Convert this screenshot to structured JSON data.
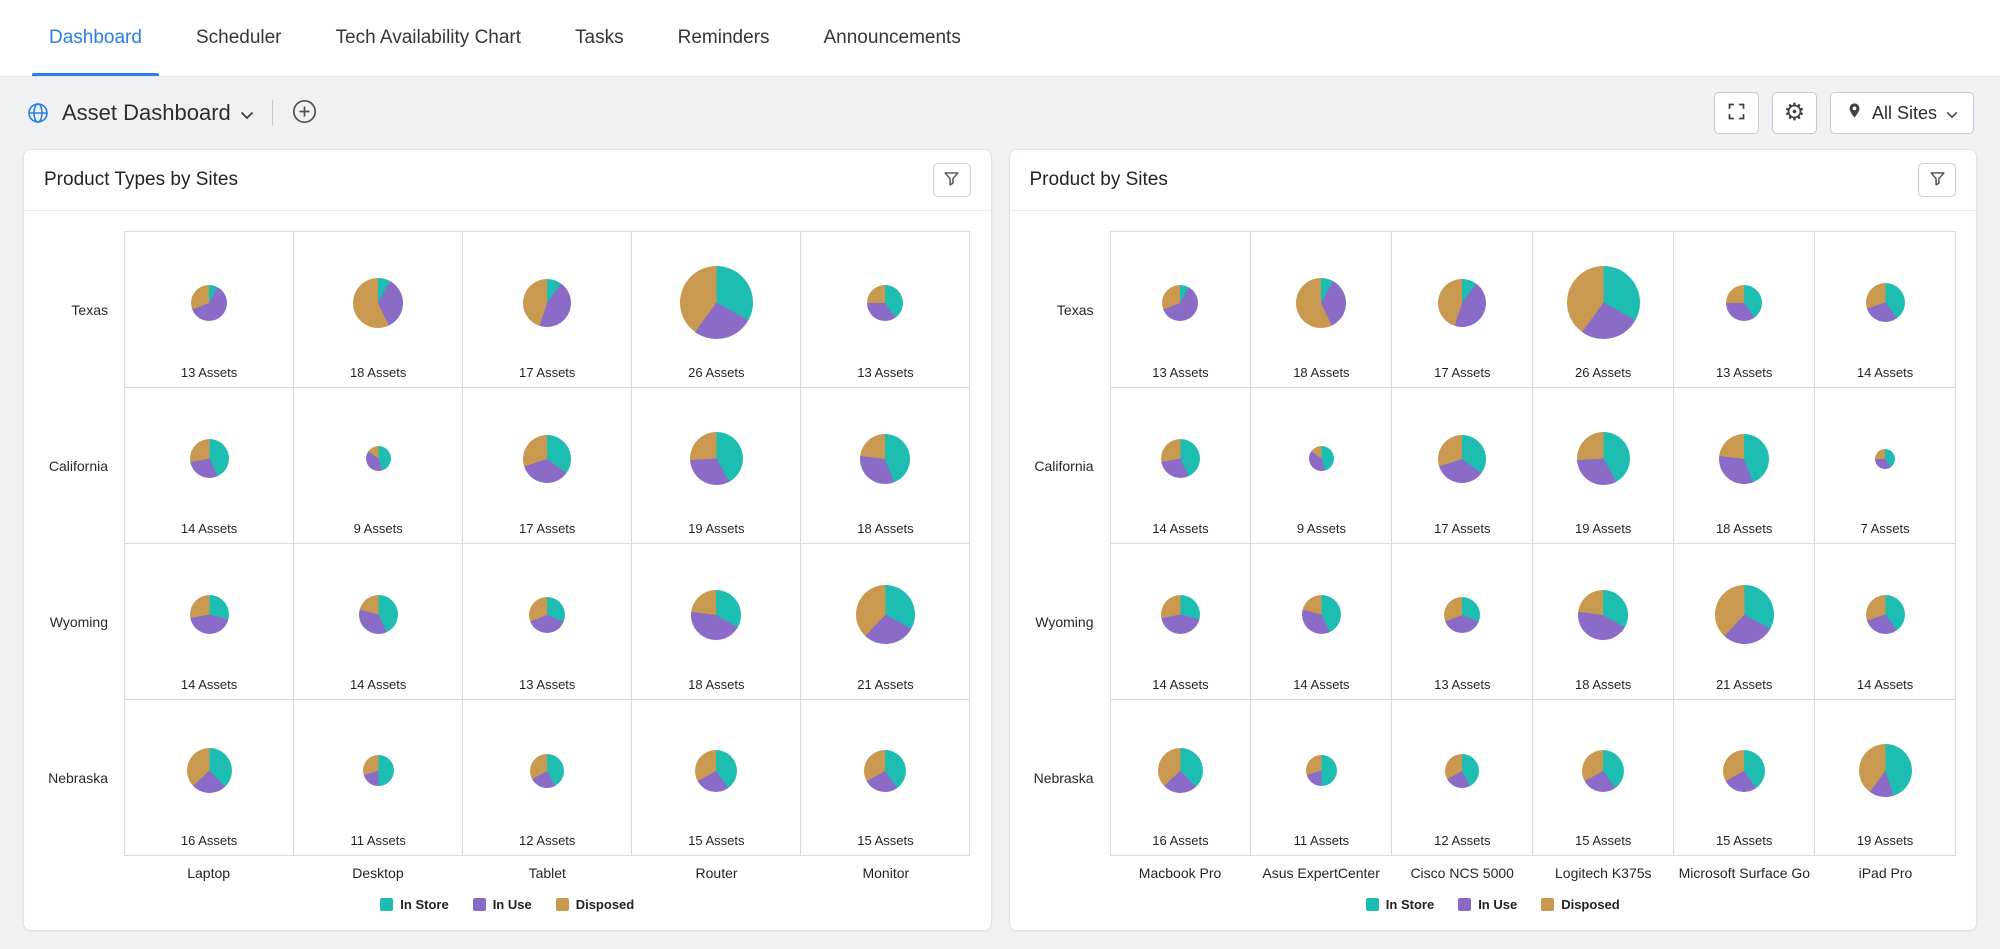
{
  "nav": {
    "tabs": [
      {
        "label": "Dashboard",
        "active": true
      },
      {
        "label": "Scheduler",
        "active": false
      },
      {
        "label": "Tech Availability Chart",
        "active": false
      },
      {
        "label": "Tasks",
        "active": false
      },
      {
        "label": "Reminders",
        "active": false
      },
      {
        "label": "Announcements",
        "active": false
      }
    ]
  },
  "toolbar": {
    "title": "Asset Dashboard",
    "site_filter_label": "All Sites"
  },
  "colors": {
    "accent_blue": "#2b7de9",
    "in_store": "#1ebdb2",
    "in_use": "#8a6cc8",
    "disposed": "#c9994f"
  },
  "chart_data": [
    {
      "type": "pie",
      "title": "Product Types by Sites",
      "rows": [
        "Texas",
        "California",
        "Wyoming",
        "Nebraska"
      ],
      "columns": [
        "Laptop",
        "Desktop",
        "Tablet",
        "Router",
        "Monitor"
      ],
      "series_labels": [
        "In Store",
        "In Use",
        "Disposed"
      ],
      "series_colors": [
        "#1ebdb2",
        "#8a6cc8",
        "#c9994f"
      ],
      "count_suffix": "Assets",
      "cells": [
        [
          {
            "total": 13,
            "pct": [
              8,
              61,
              31
            ]
          },
          {
            "total": 18,
            "pct": [
              8,
              35,
              57
            ]
          },
          {
            "total": 17,
            "pct": [
              10,
              45,
              45
            ]
          },
          {
            "total": 26,
            "pct": [
              33,
              27,
              40
            ]
          },
          {
            "total": 13,
            "pct": [
              40,
              35,
              25
            ]
          }
        ],
        [
          {
            "total": 14,
            "pct": [
              43,
              29,
              28
            ]
          },
          {
            "total": 9,
            "pct": [
              45,
              40,
              15
            ]
          },
          {
            "total": 17,
            "pct": [
              35,
              35,
              30
            ]
          },
          {
            "total": 19,
            "pct": [
              42,
              32,
              26
            ]
          },
          {
            "total": 18,
            "pct": [
              44,
              33,
              23
            ]
          }
        ],
        [
          {
            "total": 14,
            "pct": [
              29,
              43,
              28
            ]
          },
          {
            "total": 14,
            "pct": [
              43,
              36,
              21
            ]
          },
          {
            "total": 13,
            "pct": [
              31,
              38,
              31
            ]
          },
          {
            "total": 18,
            "pct": [
              33,
              44,
              23
            ]
          },
          {
            "total": 21,
            "pct": [
              33,
              29,
              38
            ]
          }
        ],
        [
          {
            "total": 16,
            "pct": [
              38,
              25,
              37
            ]
          },
          {
            "total": 11,
            "pct": [
              50,
              20,
              30
            ]
          },
          {
            "total": 12,
            "pct": [
              42,
              25,
              33
            ]
          },
          {
            "total": 15,
            "pct": [
              40,
              27,
              33
            ]
          },
          {
            "total": 15,
            "pct": [
              40,
              27,
              33
            ]
          }
        ]
      ]
    },
    {
      "type": "pie",
      "title": "Product by Sites",
      "rows": [
        "Texas",
        "California",
        "Wyoming",
        "Nebraska"
      ],
      "columns": [
        "Macbook Pro",
        "Asus ExpertCenter",
        "Cisco NCS 5000",
        "Logitech K375s",
        "Microsoft Surface Go",
        "iPad Pro"
      ],
      "series_labels": [
        "In Store",
        "In Use",
        "Disposed"
      ],
      "series_colors": [
        "#1ebdb2",
        "#8a6cc8",
        "#c9994f"
      ],
      "count_suffix": "Assets",
      "cells": [
        [
          {
            "total": 13,
            "pct": [
              8,
              61,
              31
            ]
          },
          {
            "total": 18,
            "pct": [
              8,
              35,
              57
            ]
          },
          {
            "total": 17,
            "pct": [
              10,
              45,
              45
            ]
          },
          {
            "total": 26,
            "pct": [
              33,
              27,
              40
            ]
          },
          {
            "total": 13,
            "pct": [
              40,
              35,
              25
            ]
          },
          {
            "total": 14,
            "pct": [
              40,
              30,
              30
            ]
          }
        ],
        [
          {
            "total": 14,
            "pct": [
              43,
              29,
              28
            ]
          },
          {
            "total": 9,
            "pct": [
              45,
              40,
              15
            ]
          },
          {
            "total": 17,
            "pct": [
              35,
              35,
              30
            ]
          },
          {
            "total": 19,
            "pct": [
              42,
              32,
              26
            ]
          },
          {
            "total": 18,
            "pct": [
              44,
              33,
              23
            ]
          },
          {
            "total": 7,
            "pct": [
              40,
              35,
              25
            ]
          }
        ],
        [
          {
            "total": 14,
            "pct": [
              29,
              43,
              28
            ]
          },
          {
            "total": 14,
            "pct": [
              43,
              36,
              21
            ]
          },
          {
            "total": 13,
            "pct": [
              31,
              38,
              31
            ]
          },
          {
            "total": 18,
            "pct": [
              33,
              44,
              23
            ]
          },
          {
            "total": 21,
            "pct": [
              33,
              29,
              38
            ]
          },
          {
            "total": 14,
            "pct": [
              40,
              30,
              30
            ]
          }
        ],
        [
          {
            "total": 16,
            "pct": [
              38,
              25,
              37
            ]
          },
          {
            "total": 11,
            "pct": [
              50,
              20,
              30
            ]
          },
          {
            "total": 12,
            "pct": [
              42,
              25,
              33
            ]
          },
          {
            "total": 15,
            "pct": [
              40,
              27,
              33
            ]
          },
          {
            "total": 15,
            "pct": [
              40,
              27,
              33
            ]
          },
          {
            "total": 19,
            "pct": [
              45,
              15,
              40
            ]
          }
        ]
      ]
    }
  ]
}
